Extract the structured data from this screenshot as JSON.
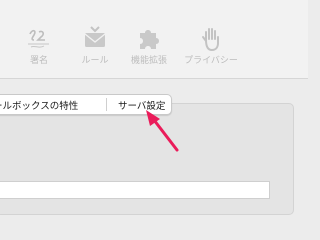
{
  "toolbar": {
    "items": [
      {
        "label": "署名",
        "icon": "signature-icon"
      },
      {
        "label": "ルール",
        "icon": "envelope-rules-icon"
      },
      {
        "label": "機能拡張",
        "icon": "puzzle-piece-icon"
      },
      {
        "label": "プライバシー",
        "icon": "raised-hand-icon"
      }
    ]
  },
  "tabs": {
    "items": [
      {
        "label": "ールボックスの特性"
      },
      {
        "label": "サーバ設定"
      }
    ]
  },
  "colors": {
    "toolbar_background": "#f2f2f2",
    "disabled_text": "#bcbcbc",
    "annotation_arrow": "#ea1c5a"
  }
}
